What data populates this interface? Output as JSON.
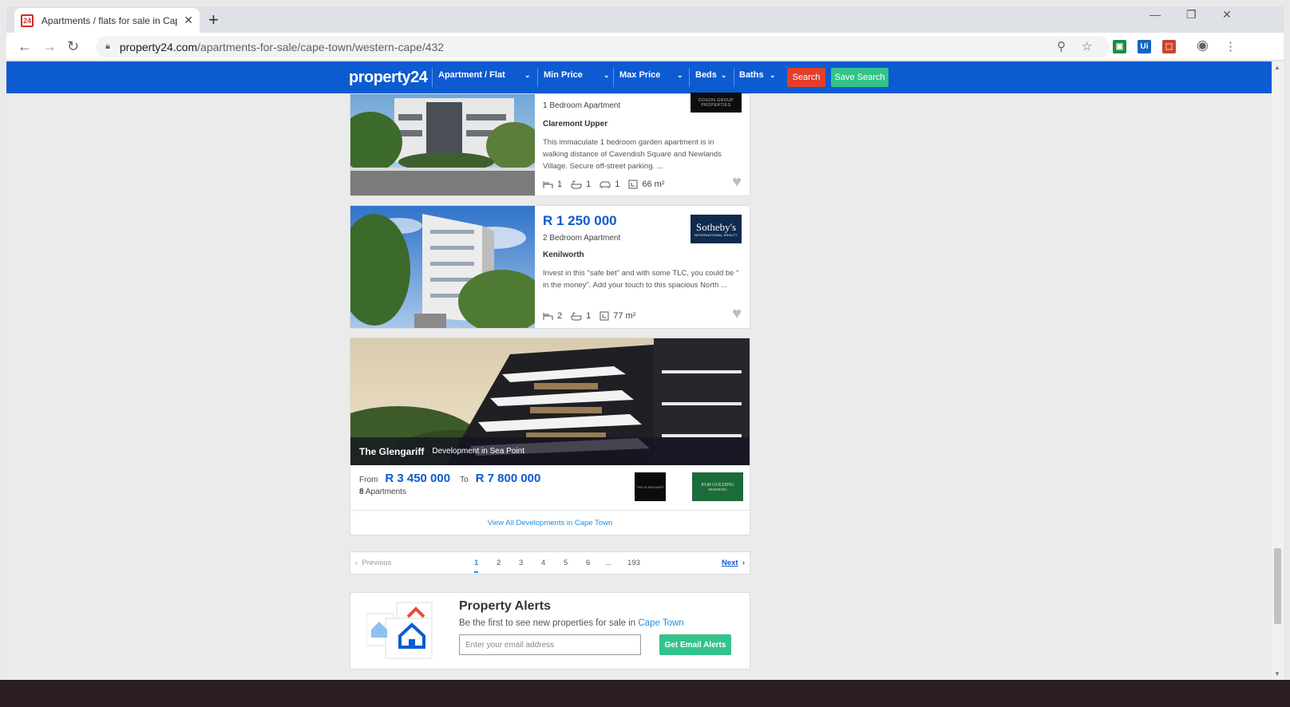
{
  "browser": {
    "tab_title": "Apartments / flats for sale in Cap",
    "favicon_text": "24",
    "url_host": "property24.com",
    "url_path": "/apartments-for-sale/cape-town/western-cape/432",
    "extensions": [
      "meet-icon",
      "ui-icon",
      "pdf-icon"
    ]
  },
  "header": {
    "logo": "property24",
    "filters": {
      "type": "Apartment / Flat",
      "min_price": "Min Price",
      "max_price": "Max Price",
      "beds": "Beds",
      "baths": "Baths"
    },
    "search_label": "Search",
    "save_search_label": "Save Search",
    "colors": {
      "brand_blue": "#0c5bd1",
      "search_red": "#e43e2b",
      "save_green": "#33c38a"
    }
  },
  "listings": [
    {
      "type": "1 Bedroom Apartment",
      "suburb": "Claremont Upper",
      "description": "This immaculate 1 bedroom garden apartment is in walking distance of Cavendish Square and Newlands Village. Secure off-street parking. ...",
      "beds": "1",
      "baths": "1",
      "parking": "1",
      "size": "66 m²",
      "agency": "DOGON GROUP PROPERTIES"
    },
    {
      "price": "R 1 250 000",
      "type": "2 Bedroom Apartment",
      "suburb": "Kenilworth",
      "description": "Invest in this \"safe bet\" and with some TLC, you could be \" in the money\". Add your touch to this spacious North ...",
      "beds": "2",
      "baths": "1",
      "size": "77 m²",
      "agency": "Sotheby's",
      "agency_sub": "INTERNATIONAL REALTY"
    }
  ],
  "development": {
    "name": "The Glengariff",
    "subtitle": "Development in Sea Point",
    "from_label": "From",
    "from_price": "R 3 450 000",
    "to_label": "To",
    "to_price": "R 7 800 000",
    "count": "8",
    "count_label": "Apartments",
    "logo1": "THE GLENGARIFF",
    "logo2": "PAM GOLDING",
    "logo2_sub": "PROPERTIES",
    "view_all": "View All Developments in Cape Town"
  },
  "pagination": {
    "previous": "Previous",
    "next": "Next",
    "pages": [
      "1",
      "2",
      "3",
      "4",
      "5",
      "6",
      "...",
      "193"
    ],
    "current": "1"
  },
  "alerts": {
    "title": "Property Alerts",
    "subtitle_prefix": "Be the first to see new properties for sale in",
    "city": "Cape Town",
    "email_placeholder": "Enter your email address",
    "button": "Get Email Alerts"
  }
}
